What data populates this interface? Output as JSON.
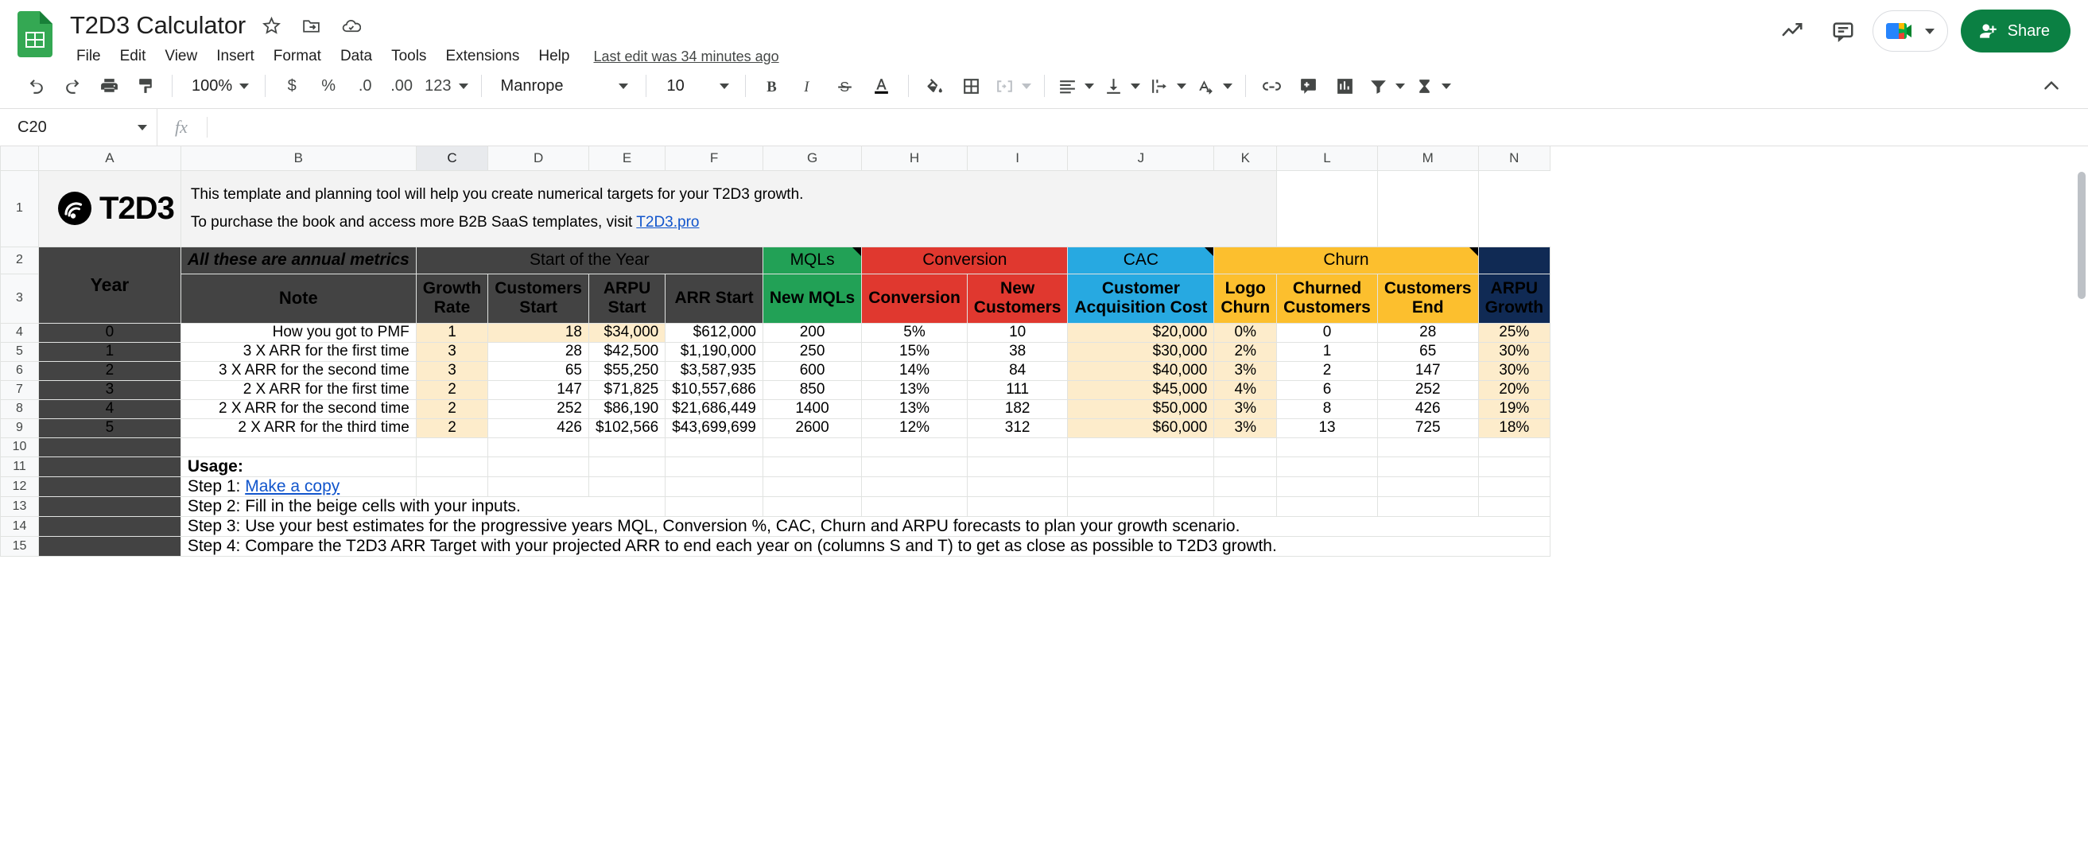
{
  "app": {
    "doc_title": "T2D3 Calculator",
    "last_edit": "Last edit was 34 minutes ago",
    "share_label": "Share",
    "menu_items": [
      "File",
      "Edit",
      "View",
      "Insert",
      "Format",
      "Data",
      "Tools",
      "Extensions",
      "Help"
    ],
    "title_icons": [
      "star-icon",
      "move-to-folder-icon",
      "cloud-saved-icon"
    ],
    "right_icons": [
      "activity-trend-icon",
      "comment-history-icon",
      "meet-call-icon"
    ],
    "accent_green": "#0b8043"
  },
  "toolbar": {
    "zoom": "100%",
    "font_family": "Manrope",
    "font_size": "10",
    "items": [
      "undo-icon",
      "redo-icon",
      "print-icon",
      "paint-format-icon",
      "currency-format",
      "percent-format",
      "decrease-decimal",
      "increase-decimal",
      "more-formats",
      "bold",
      "italic",
      "strikethrough",
      "text-color",
      "fill-color",
      "borders",
      "merge-cells",
      "horizontal-align",
      "vertical-align",
      "text-wrap",
      "text-rotation",
      "insert-link",
      "insert-comment",
      "insert-chart",
      "create-filter",
      "functions"
    ],
    "decimal_less": ".0",
    "decimal_more": ".00",
    "number_format": "123"
  },
  "formula_bar": {
    "cell_ref": "C20",
    "formula": "",
    "fx_label": "fx"
  },
  "grid": {
    "columns": [
      "A",
      "B",
      "C",
      "D",
      "E",
      "F",
      "G",
      "H",
      "I",
      "J",
      "K",
      "L",
      "M",
      "N"
    ],
    "selected_column": "C",
    "row_numbers": [
      "1",
      "2",
      "3",
      "4",
      "5",
      "6",
      "7",
      "8",
      "9",
      "10",
      "11",
      "12",
      "13",
      "14",
      "15"
    ]
  },
  "sheet": {
    "logo_text": "T2D3",
    "intro_line1": "This template and planning tool will help you create numerical targets for your T2D3 growth.",
    "intro_line2_pre": "To purchase the book and access more B2B SaaS templates, visit ",
    "intro_line2_link": "T2D3.pro",
    "group_headers": {
      "note_group": "All these are annual metrics",
      "start_of_year": "Start of the Year",
      "mqls": "MQLs",
      "conversion": "Conversion",
      "cac": "CAC",
      "churn": "Churn",
      "arpu_growth": "ARPU Growth"
    },
    "col_headers": {
      "year": "Year",
      "note": "Note",
      "growth_rate": "Growth\nRate",
      "growth_rate_l1": "Growth",
      "growth_rate_l2": "Rate",
      "customers_start_l1": "Customers",
      "customers_start_l2": "Start",
      "arpu_start_l1": "ARPU",
      "arpu_start_l2": "Start",
      "arr_start": "ARR Start",
      "new_mqls": "New MQLs",
      "conversion": "Conversion",
      "new_customers_l1": "New",
      "new_customers_l2": "Customers",
      "cac_l1": "Customer",
      "cac_l2": "Acquisition Cost",
      "logo_churn_l1": "Logo",
      "logo_churn_l2": "Churn",
      "churned_customers_l1": "Churned",
      "churned_customers_l2": "Customers",
      "customers_end_l1": "Customers",
      "customers_end_l2": "End",
      "arpu_growth_l1": "ARPU",
      "arpu_growth_l2": "Growth"
    },
    "rows": [
      {
        "year": "0",
        "note": "How you got to PMF",
        "growth_rate": "1",
        "customers_start": "18",
        "arpu_start": "$34,000",
        "arr_start": "$612,000",
        "new_mqls": "200",
        "conversion": "5%",
        "new_customers": "10",
        "cac": "$20,000",
        "logo_churn": "0%",
        "churned_customers": "0",
        "customers_end": "28",
        "arpu_growth": "25%"
      },
      {
        "year": "1",
        "note": "3 X ARR for the first time",
        "growth_rate": "3",
        "customers_start": "28",
        "arpu_start": "$42,500",
        "arr_start": "$1,190,000",
        "new_mqls": "250",
        "conversion": "15%",
        "new_customers": "38",
        "cac": "$30,000",
        "logo_churn": "2%",
        "churned_customers": "1",
        "customers_end": "65",
        "arpu_growth": "30%"
      },
      {
        "year": "2",
        "note": "3 X ARR for the second time",
        "growth_rate": "3",
        "customers_start": "65",
        "arpu_start": "$55,250",
        "arr_start": "$3,587,935",
        "new_mqls": "600",
        "conversion": "14%",
        "new_customers": "84",
        "cac": "$40,000",
        "logo_churn": "3%",
        "churned_customers": "2",
        "customers_end": "147",
        "arpu_growth": "30%"
      },
      {
        "year": "3",
        "note": "2 X ARR for the first time",
        "growth_rate": "2",
        "customers_start": "147",
        "arpu_start": "$71,825",
        "arr_start": "$10,557,686",
        "new_mqls": "850",
        "conversion": "13%",
        "new_customers": "111",
        "cac": "$45,000",
        "logo_churn": "4%",
        "churned_customers": "6",
        "customers_end": "252",
        "arpu_growth": "20%"
      },
      {
        "year": "4",
        "note": "2 X ARR for the second time",
        "growth_rate": "2",
        "customers_start": "252",
        "arpu_start": "$86,190",
        "arr_start": "$21,686,449",
        "new_mqls": "1400",
        "conversion": "13%",
        "new_customers": "182",
        "cac": "$50,000",
        "logo_churn": "3%",
        "churned_customers": "8",
        "customers_end": "426",
        "arpu_growth": "19%"
      },
      {
        "year": "5",
        "note": "2 X ARR for the third time",
        "growth_rate": "2",
        "customers_start": "426",
        "arpu_start": "$102,566",
        "arr_start": "$43,699,699",
        "new_mqls": "2600",
        "conversion": "12%",
        "new_customers": "312",
        "cac": "$60,000",
        "logo_churn": "3%",
        "churned_customers": "13",
        "customers_end": "725",
        "arpu_growth": "18%"
      }
    ],
    "usage": {
      "title": "Usage:",
      "step1_pre": "Step 1: ",
      "step1_link": "Make a copy",
      "step2": "Step 2: Fill in the beige cells with your inputs.",
      "step3": "Step 3: Use your best estimates for the progressive years MQL, Conversion %, CAC, Churn and ARPU forecasts to plan your growth scenario.",
      "step4": "Step 4: Compare the T2D3 ARR Target with your projected ARR to end each year on (columns S and T) to get as close as possible to T2D3 growth."
    }
  }
}
